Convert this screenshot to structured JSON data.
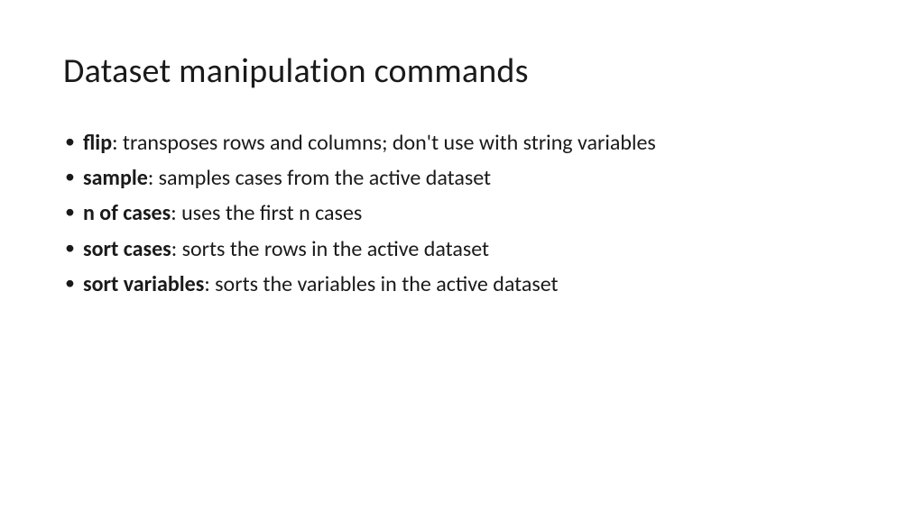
{
  "title": "Dataset manipulation commands",
  "items": [
    {
      "term": "flip",
      "desc": ": transposes rows and columns; don't use with string variables"
    },
    {
      "term": "sample",
      "desc": ":  samples cases from the active dataset"
    },
    {
      "term": "n of cases",
      "desc": ": uses the first n cases"
    },
    {
      "term": "sort cases",
      "desc": ": sorts the rows in the active dataset"
    },
    {
      "term": "sort variables",
      "desc": ": sorts the variables in the active dataset"
    }
  ]
}
